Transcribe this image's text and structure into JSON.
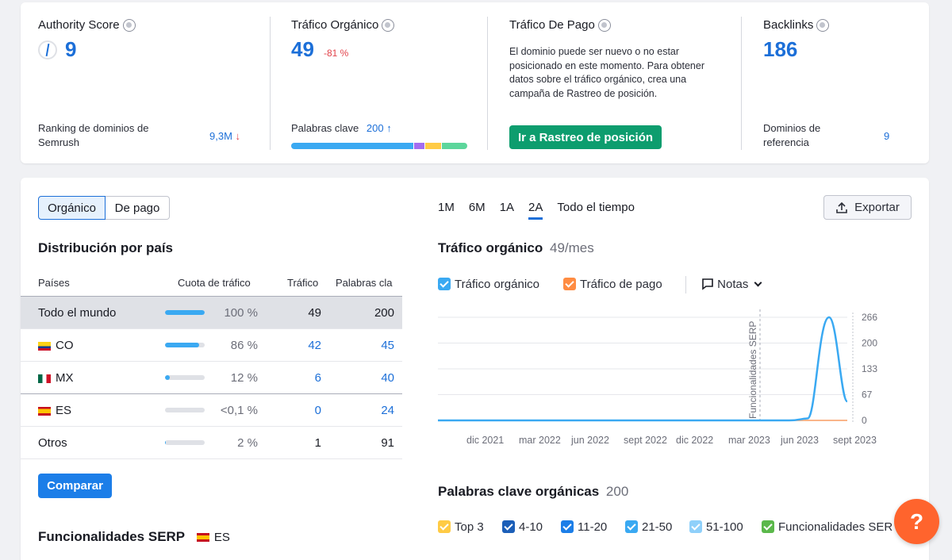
{
  "metrics": {
    "authority": {
      "title": "Authority Score",
      "value": "9",
      "rank_label": "Ranking de dominios de Semrush",
      "rank_value": "9,3M",
      "rank_arrow": "↓"
    },
    "organic": {
      "title": "Tráfico Orgánico",
      "value": "49",
      "change": "-81 %",
      "kw_label": "Palabras clave",
      "kw_value": "200",
      "kw_arrow": "↑"
    },
    "paid": {
      "title": "Tráfico De Pago",
      "description": "El dominio puede ser nuevo o no estar posicionado en este momento. Para obtener datos sobre el tráfico orgánico, crea una campaña de Rastreo de posición.",
      "button": "Ir a Rastreo de posición"
    },
    "backlinks": {
      "title": "Backlinks",
      "value": "186",
      "ref_label": "Dominios de referencia",
      "ref_value": "9"
    }
  },
  "tabs": {
    "organic": "Orgánico",
    "paid": "De pago"
  },
  "distribution": {
    "title": "Distribución por país",
    "headers": {
      "country": "Países",
      "share": "Cuota de tráfico",
      "traffic": "Tráfico",
      "keywords": "Palabras cla"
    },
    "rows": [
      {
        "name": "Todo el mundo",
        "share": "100 %",
        "share_frac": 1.0,
        "traffic": "49",
        "keywords": "200"
      },
      {
        "name": "CO",
        "share": "86 %",
        "share_frac": 0.86,
        "traffic": "42",
        "keywords": "45"
      },
      {
        "name": "MX",
        "share": "12 %",
        "share_frac": 0.12,
        "traffic": "6",
        "keywords": "40"
      },
      {
        "name": "ES",
        "share": "<0,1 %",
        "share_frac": 0.0,
        "traffic": "0",
        "keywords": "24"
      },
      {
        "name": "Otros",
        "share": "2 %",
        "share_frac": 0.02,
        "traffic": "1",
        "keywords": "91"
      }
    ],
    "compare_button": "Comparar"
  },
  "serp": {
    "title": "Funcionalidades SERP",
    "country": "ES"
  },
  "periods": [
    "1M",
    "6M",
    "1A",
    "2A",
    "Todo el tiempo"
  ],
  "active_period": "2A",
  "export_button": "Exportar",
  "traffic_chart_title": {
    "title": "Tráfico orgánico",
    "value": "49/mes"
  },
  "legend": {
    "organic": "Tráfico orgánico",
    "paid": "Tráfico de pago",
    "notes": "Notas"
  },
  "keywords_title": {
    "title": "Palabras clave orgánicas",
    "value": "200"
  },
  "kw_legend": [
    "Top 3",
    "4-10",
    "11-20",
    "21-50",
    "51-100",
    "Funcionalidades SER"
  ],
  "chart_data": {
    "type": "line",
    "x": [
      "dic 2021",
      "mar 2022",
      "jun 2022",
      "sept 2022",
      "dic 2022",
      "mar 2023",
      "jun 2023",
      "sept 2023"
    ],
    "y_ticks": [
      "266",
      "200",
      "133",
      "67",
      "0"
    ],
    "ylim": [
      0,
      266
    ],
    "annotation": "Funcionalidades SERP",
    "series": [
      {
        "name": "Tráfico orgánico",
        "values": [
          0,
          0,
          0,
          0,
          0,
          0,
          5,
          266,
          49
        ]
      },
      {
        "name": "Tráfico de pago",
        "values": [
          0,
          0,
          0,
          0,
          0,
          0,
          0,
          0,
          0
        ]
      }
    ]
  },
  "colors": {
    "accent": "#1c6fd8",
    "green": "#0d9d6e",
    "orange": "#ff642d",
    "organic_line": "#3aa9f2",
    "paid_line": "#ff8c42"
  },
  "help_label": "?"
}
